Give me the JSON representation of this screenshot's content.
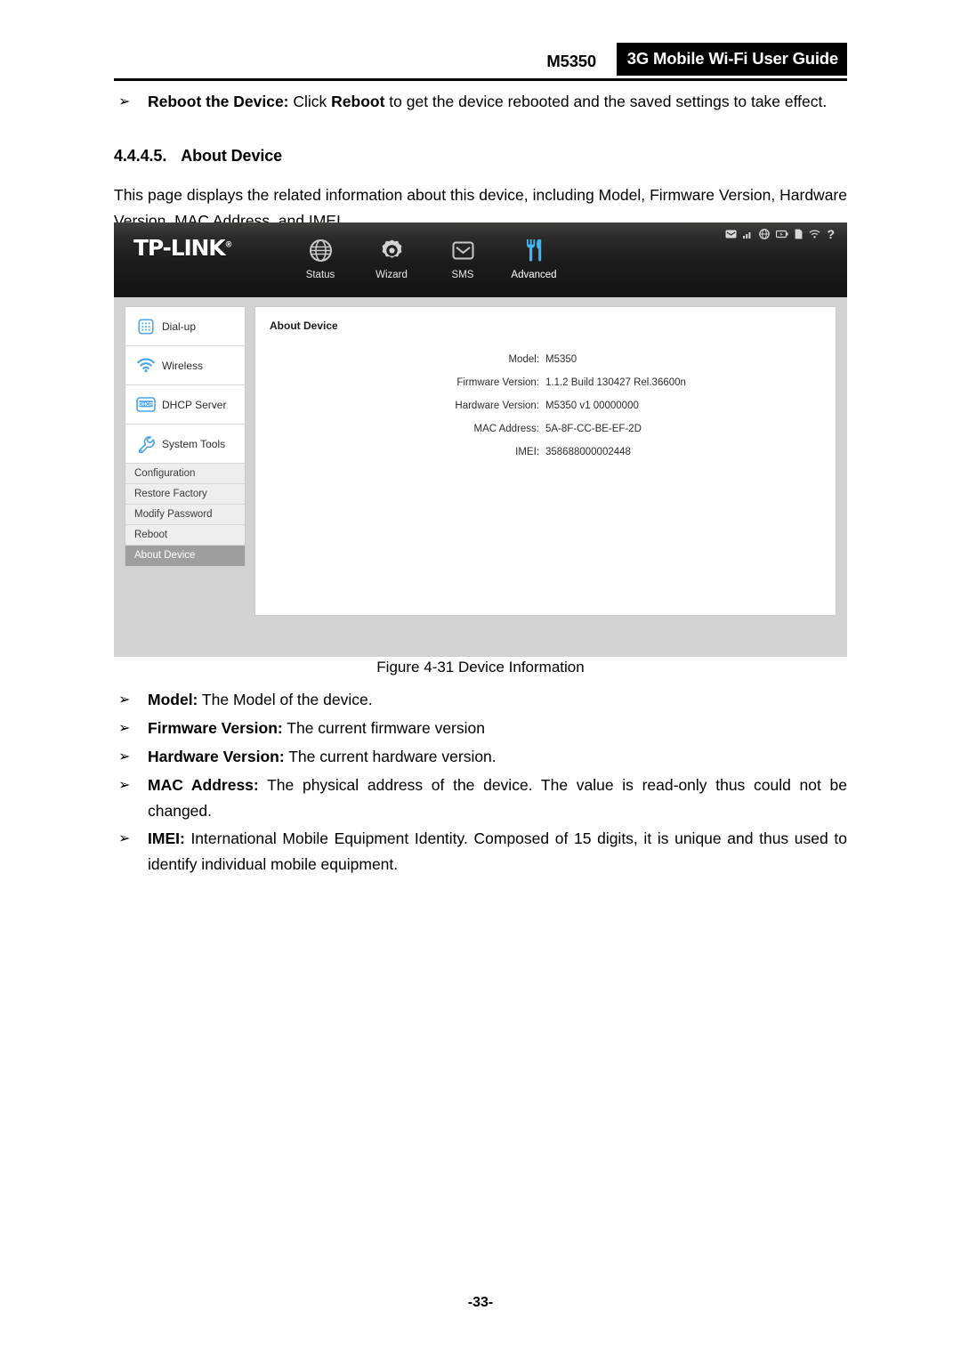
{
  "header": {
    "model": "M5350",
    "guide_title": "3G Mobile Wi-Fi User Guide"
  },
  "reboot_bullet": {
    "glyph": "➢",
    "bold_lead": "Reboot the Device:",
    "text_1": " Click ",
    "bold_mid": "Reboot",
    "text_2": " to get the device rebooted and the saved settings to take effect."
  },
  "section": {
    "number": "4.4.4.5.",
    "title": "About Device",
    "intro": "This page displays the related information about this device, including Model, Firmware Version, Hardware Version, MAC Address, and IMEI."
  },
  "screenshot": {
    "brand": "TP-LINK",
    "brand_mark": "®",
    "status_icons": [
      "envelope-icon",
      "signal-bars-icon",
      "globe-icon",
      "battery-icon",
      "sim-card-icon",
      "wifi-icon",
      "help-question-icon"
    ],
    "nav_tabs": [
      {
        "label": "Status",
        "icon": "globe-icon",
        "active": false
      },
      {
        "label": "Wizard",
        "icon": "gear-circle-icon",
        "active": false
      },
      {
        "label": "SMS",
        "icon": "envelope-icon",
        "active": false
      },
      {
        "label": "Advanced",
        "icon": "tools-fork-knife-icon",
        "active": true
      }
    ],
    "sidebar_main": [
      {
        "label": "Dial-up",
        "icon": "dialpad-icon"
      },
      {
        "label": "Wireless",
        "icon": "wifi-icon"
      },
      {
        "label": "DHCP Server",
        "icon": "dhcp-box-icon"
      },
      {
        "label": "System Tools",
        "icon": "wrench-icon"
      }
    ],
    "sidebar_sub": [
      {
        "label": "Configuration",
        "selected": false
      },
      {
        "label": "Restore Factory",
        "selected": false
      },
      {
        "label": "Modify Password",
        "selected": false
      },
      {
        "label": "Reboot",
        "selected": false
      },
      {
        "label": "About Device",
        "selected": true
      }
    ],
    "panel_title": "About Device",
    "device_info": [
      {
        "label": "Model:",
        "value": "M5350"
      },
      {
        "label": "Firmware Version:",
        "value": "1.1.2 Build 130427 Rel.36600n"
      },
      {
        "label": "Hardware Version:",
        "value": "M5350 v1 00000000"
      },
      {
        "label": "MAC Address:",
        "value": "5A-8F-CC-BE-EF-2D"
      },
      {
        "label": "IMEI:",
        "value": "358688000002448"
      }
    ],
    "accent_color": "#4da3e8",
    "selected_color": "#9e9e9e"
  },
  "figure_caption": "Figure 4-31 Device Information",
  "bullets": [
    {
      "glyph": "➢",
      "bold_lead": "Model:",
      "text": " The Model of the device."
    },
    {
      "glyph": "➢",
      "bold_lead": "Firmware Version:",
      "text": " The current firmware version"
    },
    {
      "glyph": "➢",
      "bold_lead": "Hardware Version:",
      "text": " The current hardware version."
    },
    {
      "glyph": "➢",
      "bold_lead": "MAC Address:",
      "text": " The physical address of the device. The value is read-only thus could not be changed."
    },
    {
      "glyph": "➢",
      "bold_lead": "IMEI:",
      "text": " International Mobile Equipment Identity. Composed of 15 digits, it is unique and thus used to identify individual mobile equipment."
    }
  ],
  "footer": {
    "page_number": "-33-"
  }
}
